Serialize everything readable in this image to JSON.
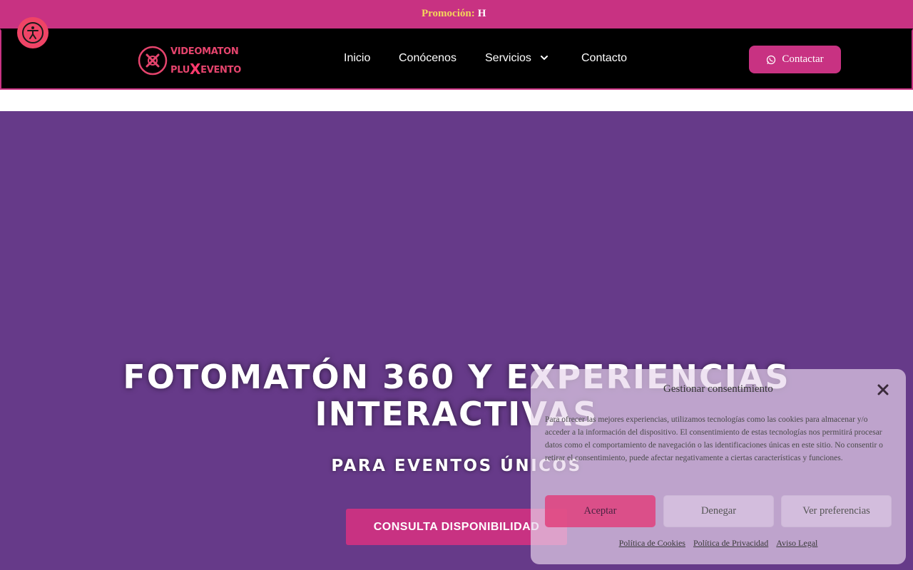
{
  "promo": {
    "label": "Promoción:",
    "value": "H"
  },
  "header": {
    "logo": {
      "line1": "VIDEOMATON",
      "line2_pre": "PLU",
      "line2_x": "X",
      "line2_post": "EVENTO"
    },
    "nav": [
      {
        "label": "Inicio"
      },
      {
        "label": "Conócenos"
      },
      {
        "label": "Servicios"
      },
      {
        "label": "Contacto"
      }
    ],
    "cta_label": "Contactar"
  },
  "hero": {
    "title": "FOTOMATÓN 360 Y EXPERIENCIAS INTERACTIVAS",
    "subtitle": "PARA EVENTOS ÚNICOS",
    "cta_label": "CONSULTA DISPONIBILIDAD"
  },
  "consent": {
    "title": "Gestionar consentimiento",
    "body": "Para ofrecer las mejores experiencias, utilizamos tecnologías como las cookies para almacenar y/o acceder a la información del dispositivo. El consentimiento de estas tecnologías nos permitirá procesar datos como el comportamiento de navegación o las identificaciones únicas en este sitio. No consentir o retirar el consentimiento, puede afectar negativamente a ciertas características y funciones.",
    "accept": "Aceptar",
    "deny": "Denegar",
    "preferences": "Ver preferencias",
    "links": [
      "Política de Cookies",
      "Política de Privacidad",
      "Aviso Legal"
    ]
  },
  "colors": {
    "brand_pink": "#c83282",
    "hero_purple": "#663a89",
    "promo_label": "#f4d65a"
  }
}
